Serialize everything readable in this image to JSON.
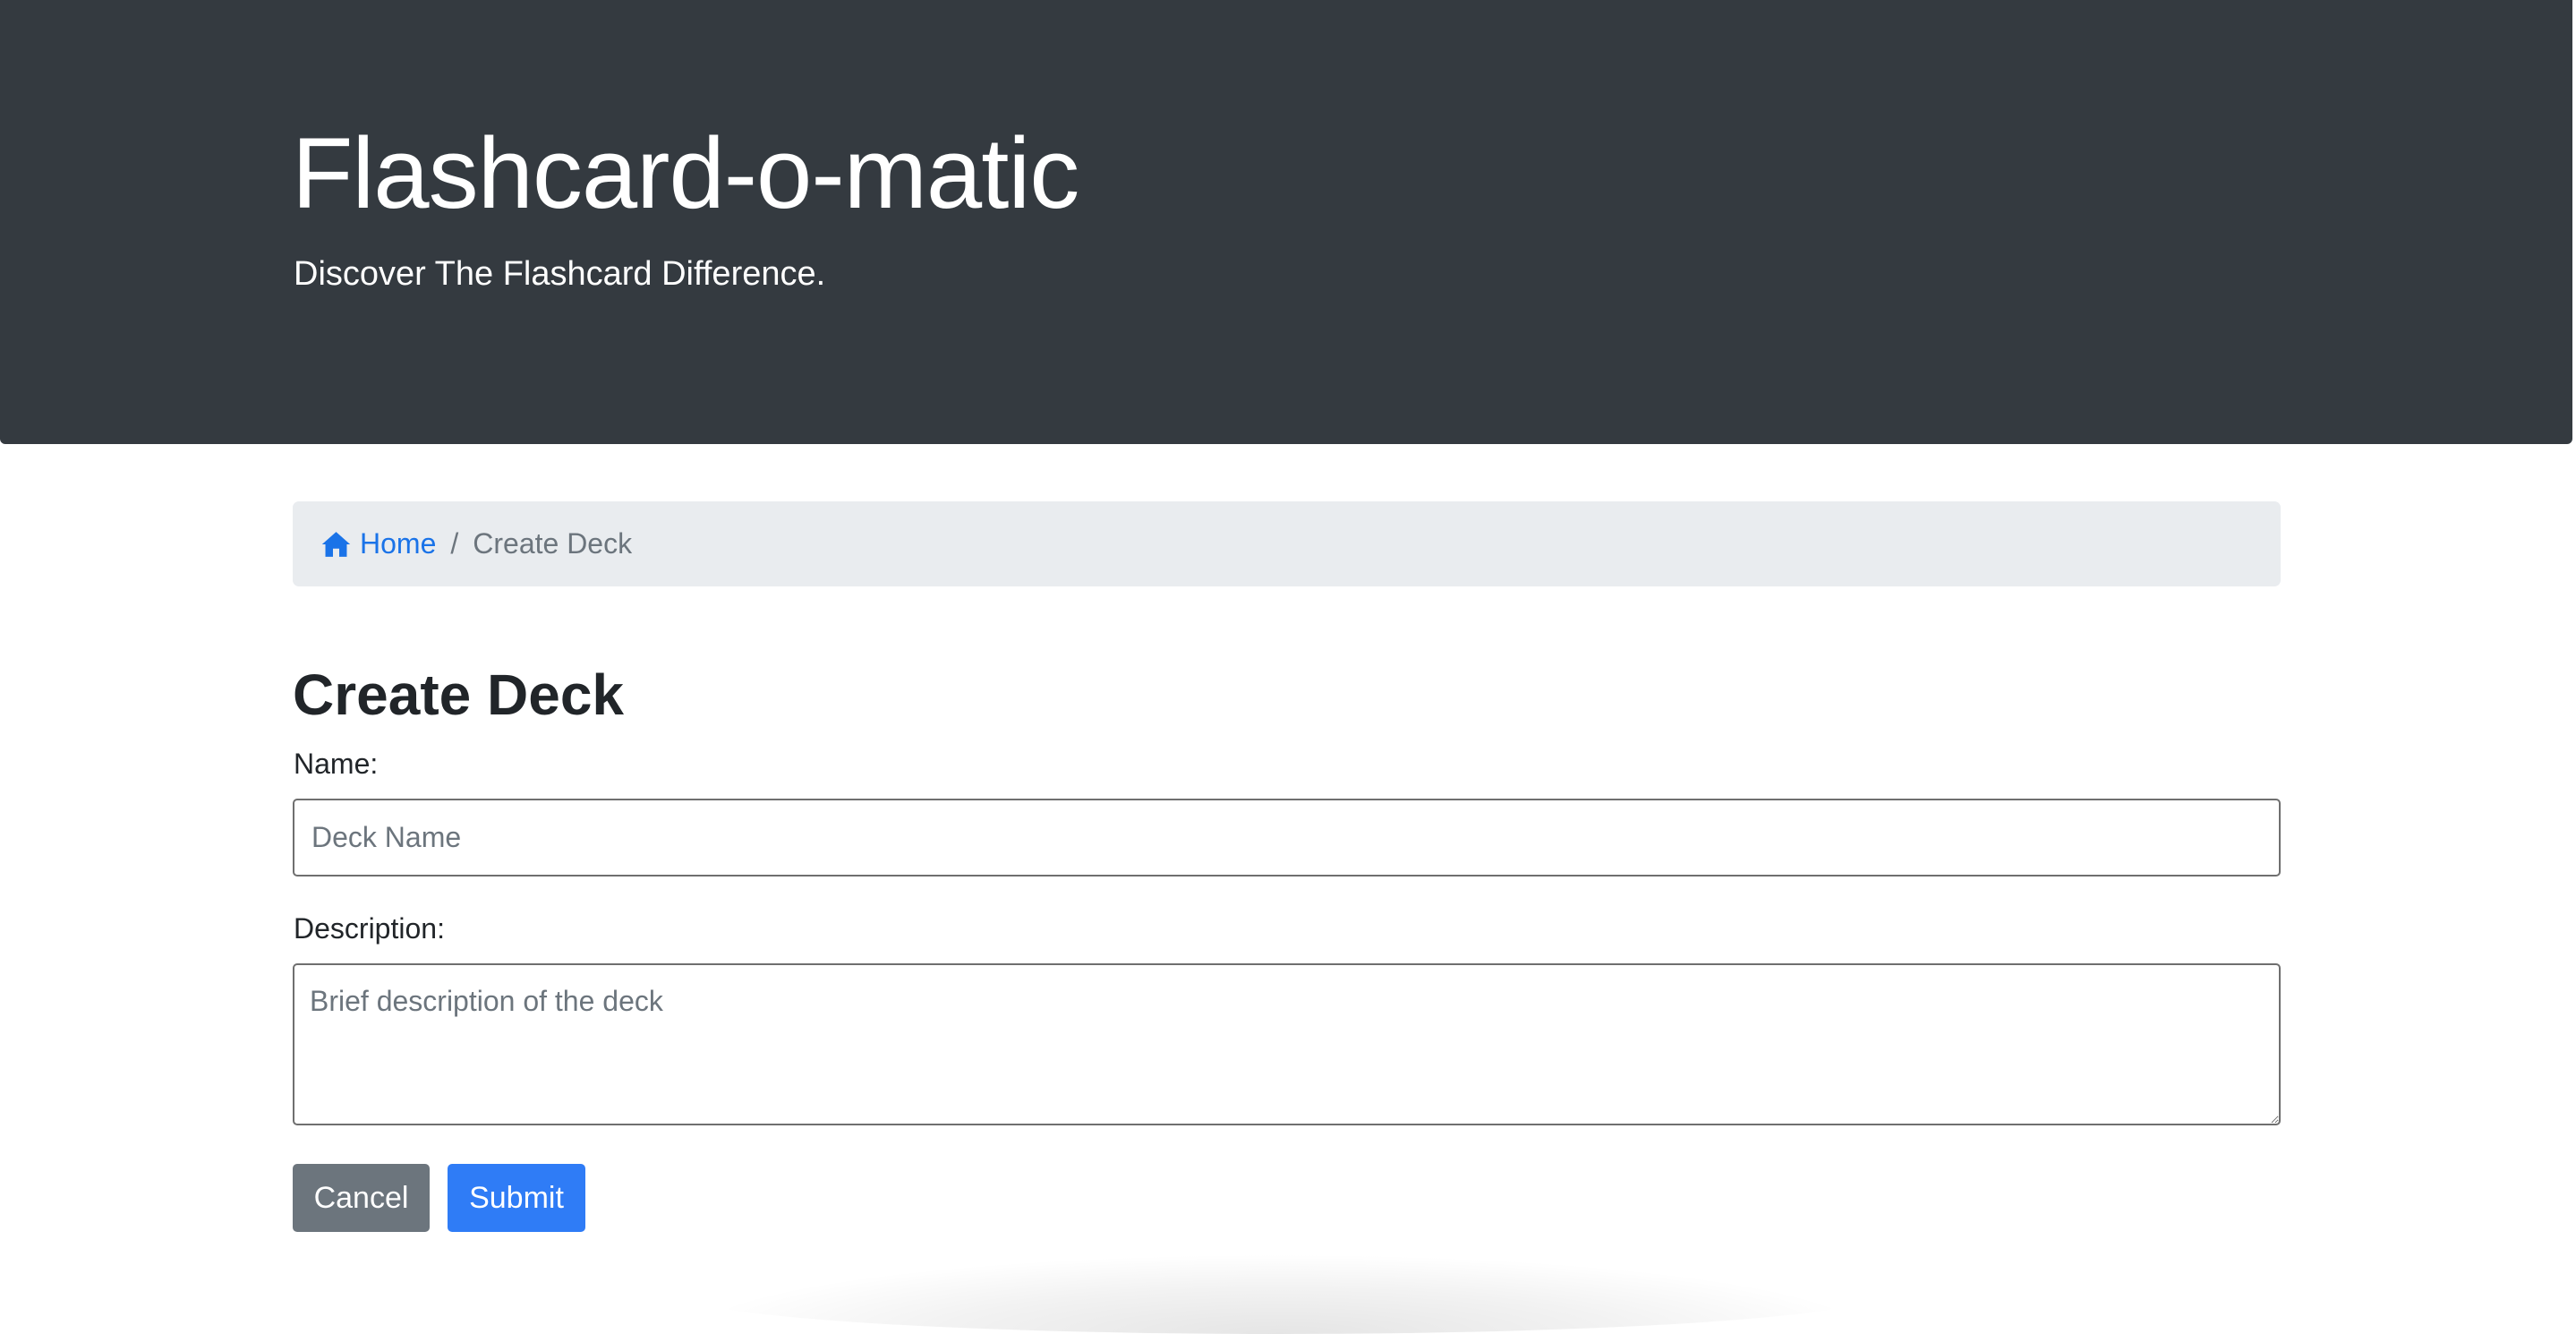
{
  "header": {
    "title": "Flashcard-o-matic",
    "subtitle": "Discover The Flashcard Difference."
  },
  "breadcrumb": {
    "home_label": "Home",
    "separator": "/",
    "current": "Create Deck",
    "home_icon": "house-icon"
  },
  "page": {
    "heading": "Create Deck"
  },
  "form": {
    "name_label": "Name:",
    "name_placeholder": "Deck Name",
    "name_value": "",
    "description_label": "Description:",
    "description_placeholder": "Brief description of the deck",
    "description_value": ""
  },
  "buttons": {
    "cancel_label": "Cancel",
    "submit_label": "Submit"
  },
  "colors": {
    "header_bg": "#343a40",
    "breadcrumb_bg": "#e9ecef",
    "link": "#1a73e8",
    "cancel_bg": "#6c757d",
    "submit_bg": "#2f7cf6"
  }
}
